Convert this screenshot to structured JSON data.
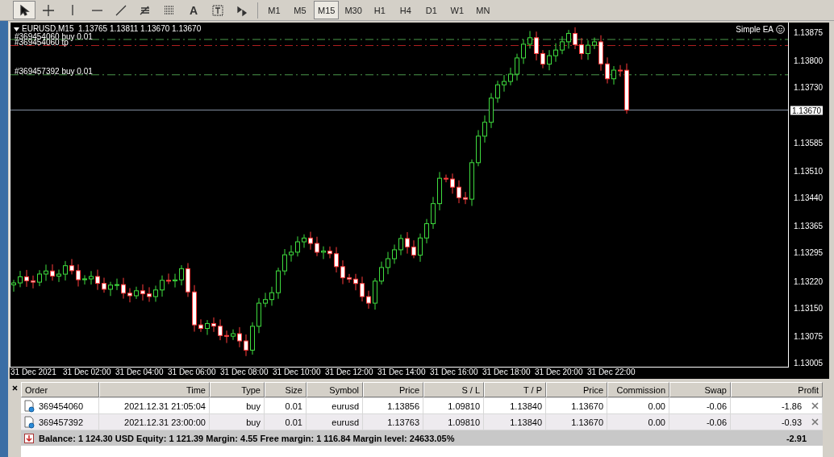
{
  "toolbar": {
    "tools": [
      {
        "kind": "cursor",
        "selected": true
      },
      {
        "kind": "crosshair",
        "selected": false
      },
      {
        "kind": "vertical-line",
        "selected": false
      },
      {
        "kind": "horizontal-line",
        "selected": false
      },
      {
        "kind": "trend-line",
        "selected": false
      },
      {
        "kind": "fibo-e",
        "selected": false
      },
      {
        "kind": "fibo-f",
        "selected": false
      },
      {
        "kind": "text",
        "label": "A",
        "selected": false
      },
      {
        "kind": "label",
        "selected": false
      },
      {
        "kind": "arrows",
        "selected": false
      }
    ],
    "timeframes": [
      {
        "label": "M1",
        "selected": false
      },
      {
        "label": "M5",
        "selected": false
      },
      {
        "label": "M15",
        "selected": true
      },
      {
        "label": "M30",
        "selected": false
      },
      {
        "label": "H1",
        "selected": false
      },
      {
        "label": "H4",
        "selected": false
      },
      {
        "label": "D1",
        "selected": false
      },
      {
        "label": "W1",
        "selected": false
      },
      {
        "label": "MN",
        "selected": false
      }
    ]
  },
  "chart": {
    "header": "EURUSD,M15  1.13765 1.13811 1.13670 1.13670",
    "order_labels": [
      "#369454060 buy 0.01",
      "#369454060 tp",
      "#369457392 buy 0.01"
    ],
    "expert": "Simple EA",
    "current_price": "1.13670",
    "price_axis": [
      "1.13875",
      "1.13800",
      "1.13730",
      "1.13585",
      "1.13510",
      "1.13440",
      "1.13365",
      "1.13295",
      "1.13220",
      "1.13150",
      "1.13075",
      "1.13005"
    ],
    "time_axis": [
      "31 Dec 2021",
      "31 Dec 02:00",
      "31 Dec 04:00",
      "31 Dec 06:00",
      "31 Dec 08:00",
      "31 Dec 10:00",
      "31 Dec 12:00",
      "31 Dec 14:00",
      "31 Dec 16:00",
      "31 Dec 18:00",
      "31 Dec 20:00",
      "31 Dec 22:00"
    ]
  },
  "terminal": {
    "columns": [
      "Order",
      "Time",
      "Type",
      "Size",
      "Symbol",
      "Price",
      "S / L",
      "T / P",
      "Price",
      "Commission",
      "Swap",
      "Profit"
    ],
    "rows": [
      {
        "cells": [
          "369454060",
          "2021.12.31 21:05:04",
          "buy",
          "0.01",
          "eurusd",
          "1.13856",
          "1.09810",
          "1.13840",
          "1.13670",
          "0.00",
          "-0.06",
          "-1.86"
        ]
      },
      {
        "cells": [
          "369457392",
          "2021.12.31 23:00:00",
          "buy",
          "0.01",
          "eurusd",
          "1.13763",
          "1.09810",
          "1.13840",
          "1.13670",
          "0.00",
          "-0.06",
          "-0.93"
        ]
      }
    ],
    "summary": "Balance: 1 124.30 USD  Equity: 1 121.39  Margin: 4.55  Free margin: 1 116.84  Margin level: 24633.05%",
    "total": "-2.91"
  }
}
